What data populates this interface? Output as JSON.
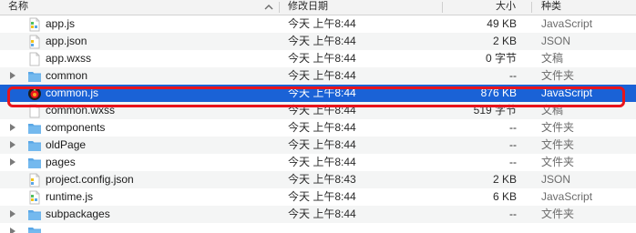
{
  "header": {
    "name_label": "名称",
    "date_label": "修改日期",
    "size_label": "大小",
    "kind_label": "种类"
  },
  "rows": [
    {
      "name": "app.js",
      "date": "今天 上午8:44",
      "size": "49 KB",
      "kind": "JavaScript",
      "icon": "js-file-icon",
      "folder": false
    },
    {
      "name": "app.json",
      "date": "今天 上午8:44",
      "size": "2 KB",
      "kind": "JSON",
      "icon": "json-file-icon",
      "folder": false
    },
    {
      "name": "app.wxss",
      "date": "今天 上午8:44",
      "size": "0 字节",
      "kind": "文稿",
      "icon": "document-icon",
      "folder": false
    },
    {
      "name": "common",
      "date": "今天 上午8:44",
      "size": "--",
      "kind": "文件夹",
      "icon": "folder-icon",
      "folder": true
    },
    {
      "name": "common.js",
      "date": "今天 上午8:44",
      "size": "876 KB",
      "kind": "JavaScript",
      "icon": "app-icon",
      "folder": false,
      "selected": true
    },
    {
      "name": "common.wxss",
      "date": "今天 上午8:44",
      "size": "519 字节",
      "kind": "文稿",
      "icon": "document-icon",
      "folder": false
    },
    {
      "name": "components",
      "date": "今天 上午8:44",
      "size": "--",
      "kind": "文件夹",
      "icon": "folder-icon",
      "folder": true
    },
    {
      "name": "oldPage",
      "date": "今天 上午8:44",
      "size": "--",
      "kind": "文件夹",
      "icon": "folder-icon",
      "folder": true
    },
    {
      "name": "pages",
      "date": "今天 上午8:44",
      "size": "--",
      "kind": "文件夹",
      "icon": "folder-icon",
      "folder": true
    },
    {
      "name": "project.config.json",
      "date": "今天 上午8:43",
      "size": "2 KB",
      "kind": "JSON",
      "icon": "json-file-icon",
      "folder": false
    },
    {
      "name": "runtime.js",
      "date": "今天 上午8:44",
      "size": "6 KB",
      "kind": "JavaScript",
      "icon": "js-file-icon",
      "folder": false
    },
    {
      "name": "subpackages",
      "date": "今天 上午8:44",
      "size": "--",
      "kind": "文件夹",
      "icon": "folder-icon",
      "folder": true
    },
    {
      "name": "",
      "date": "",
      "size": "",
      "kind": "",
      "icon": "folder-icon",
      "folder": true
    }
  ],
  "colors": {
    "selection": "#1a62d6",
    "highlight_border": "#e8141c",
    "folder": "#5aa7e6"
  }
}
